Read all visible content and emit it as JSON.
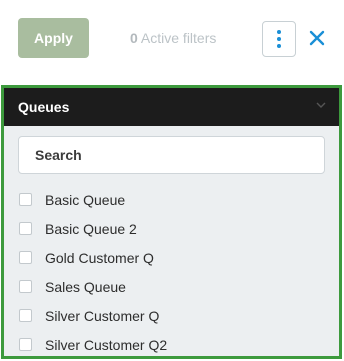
{
  "toolbar": {
    "apply_label": "Apply",
    "active_count": "0",
    "active_text": "Active filters",
    "more_icon": "kebab-vertical-icon",
    "close_icon": "close-icon"
  },
  "panel": {
    "title": "Queues",
    "collapse_icon": "chevron-down-icon",
    "search_placeholder": "Search",
    "items": [
      {
        "label": "Basic Queue",
        "checked": false
      },
      {
        "label": "Basic Queue 2",
        "checked": false
      },
      {
        "label": "Gold Customer Q",
        "checked": false
      },
      {
        "label": "Sales Queue",
        "checked": false
      },
      {
        "label": "Silver Customer Q",
        "checked": false
      },
      {
        "label": "Silver Customer Q2",
        "checked": false
      }
    ]
  },
  "colors": {
    "accent": "#1a8fd6",
    "apply_disabled": "#a9bd9f",
    "panel_border": "#3d9a3d",
    "panel_header": "#1c1c1c"
  }
}
